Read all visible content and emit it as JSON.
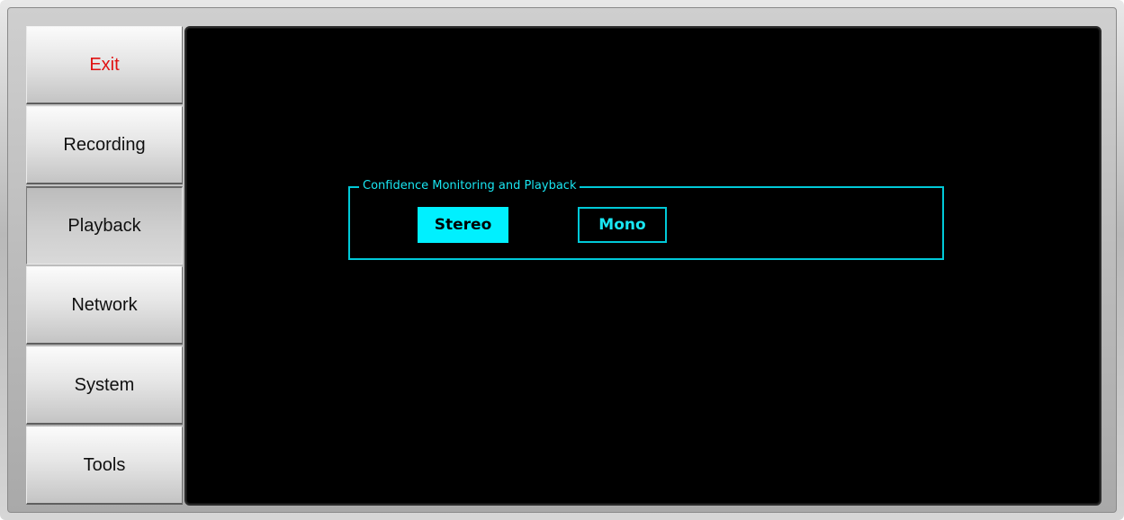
{
  "sidebar": {
    "items": [
      {
        "label": "Exit"
      },
      {
        "label": "Recording"
      },
      {
        "label": "Playback"
      },
      {
        "label": "Network"
      },
      {
        "label": "System"
      },
      {
        "label": "Tools"
      }
    ],
    "active": "Playback"
  },
  "panel": {
    "group_title": "Confidence Monitoring and Playback",
    "options": [
      {
        "label": "Stereo",
        "selected": true
      },
      {
        "label": "Mono",
        "selected": false
      }
    ]
  },
  "colors": {
    "accent": "#00f0ff",
    "exit_text": "#e01010",
    "screen_bg": "#000000"
  }
}
